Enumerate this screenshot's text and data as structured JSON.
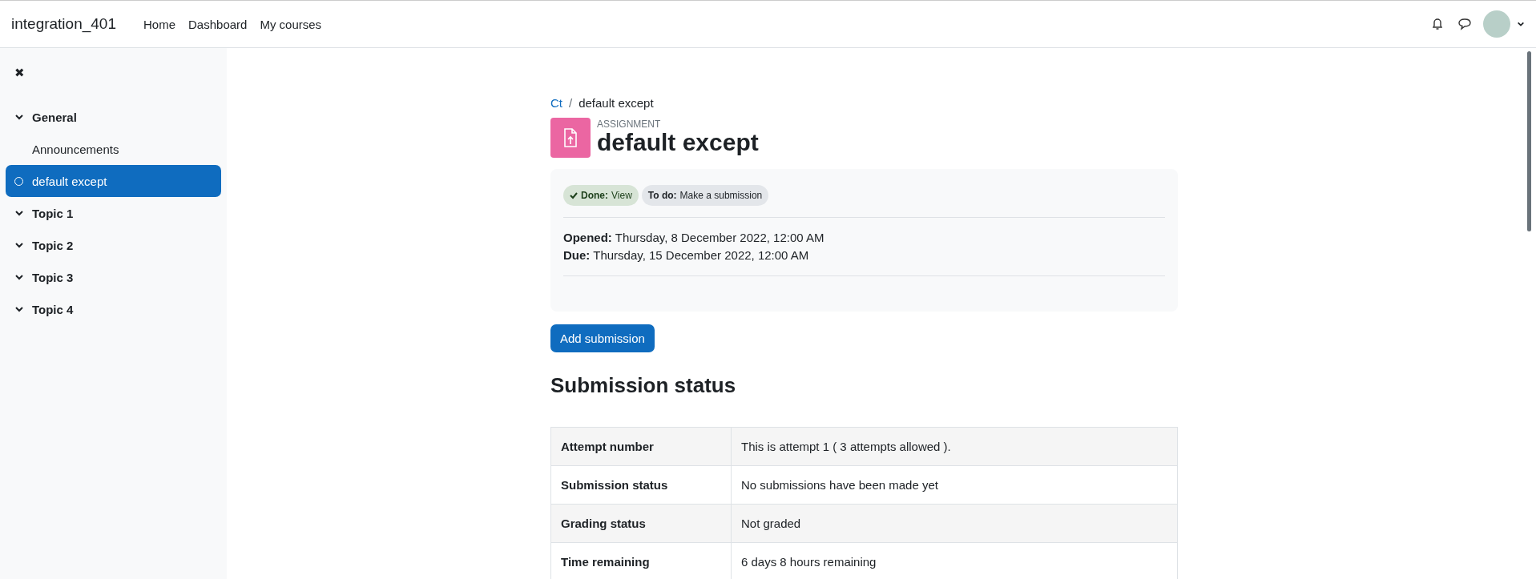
{
  "navbar": {
    "site_name": "integration_401",
    "links": [
      "Home",
      "Dashboard",
      "My courses"
    ]
  },
  "sidebar": {
    "close": "✖",
    "items": [
      {
        "kind": "section",
        "label": "General",
        "expanded": true,
        "selected": false,
        "children": [
          {
            "kind": "activity",
            "label": "Announcements",
            "selected": false,
            "marker": false
          },
          {
            "kind": "activity",
            "label": "default except",
            "selected": true,
            "marker": true
          }
        ]
      },
      {
        "kind": "section",
        "label": "Topic 1",
        "expanded": true,
        "selected": false
      },
      {
        "kind": "section",
        "label": "Topic 2",
        "expanded": true,
        "selected": false
      },
      {
        "kind": "section",
        "label": "Topic 3",
        "expanded": true,
        "selected": false
      },
      {
        "kind": "section",
        "label": "Topic 4",
        "expanded": true,
        "selected": false
      }
    ]
  },
  "breadcrumb": {
    "separator": "/",
    "items": [
      {
        "label": "Ct",
        "link": true
      },
      {
        "label": "default except",
        "link": false
      }
    ]
  },
  "activity": {
    "type_label": "ASSIGNMENT",
    "title": "default except"
  },
  "completion": [
    {
      "label": "Done:",
      "value": "View",
      "done": true
    },
    {
      "label": "To do:",
      "value": "Make a submission",
      "done": false
    }
  ],
  "dates": [
    {
      "label": "Opened:",
      "value": "Thursday, 8 December 2022, 12:00 AM"
    },
    {
      "label": "Due:",
      "value": "Thursday, 15 December 2022, 12:00 AM"
    }
  ],
  "action_button": "Add submission",
  "section_heading": "Submission status",
  "status_table": [
    {
      "label": "Attempt number",
      "value": "This is attempt 1 ( 3 attempts allowed )."
    },
    {
      "label": "Submission status",
      "value": "No submissions have been made yet"
    },
    {
      "label": "Grading status",
      "value": "Not graded"
    },
    {
      "label": "Time remaining",
      "value": "6 days 8 hours remaining"
    }
  ]
}
